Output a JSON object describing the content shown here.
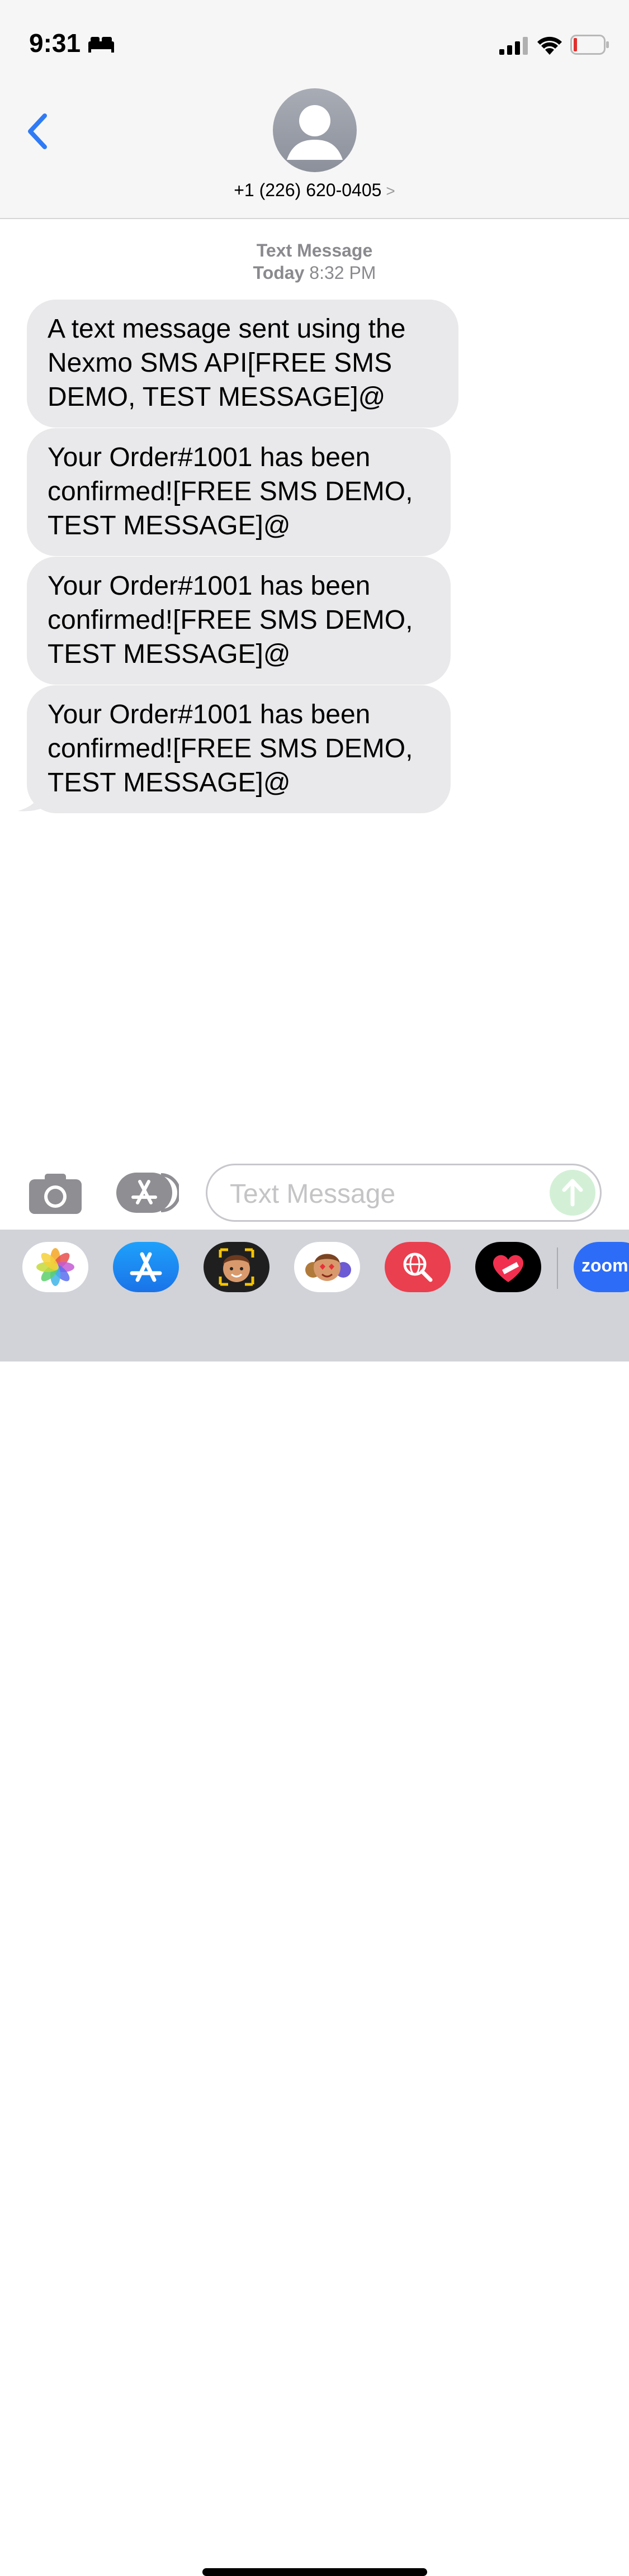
{
  "status_bar": {
    "time": "9:31",
    "icons": [
      "bed-icon",
      "cellular-signal-icon",
      "wifi-icon",
      "battery-low-icon"
    ]
  },
  "header": {
    "back_icon": "chevron-left-icon",
    "contact_number": "+1 (226) 620-0405",
    "detail_chevron": ">"
  },
  "conversation": {
    "service_label": "Text Message",
    "date_day": "Today",
    "date_time": "8:32 PM",
    "messages": [
      {
        "text": "A text message sent using the Nexmo SMS API[FREE SMS DEMO, TEST MESSAGE]@"
      },
      {
        "text": "Your Order#1001 has been confirmed![FREE SMS DEMO, TEST MESSAGE]@"
      },
      {
        "text": "Your Order#1001 has been confirmed![FREE SMS DEMO, TEST MESSAGE]@"
      },
      {
        "text": "Your Order#1001 has been confirmed![FREE SMS DEMO, TEST MESSAGE]@"
      }
    ]
  },
  "composer": {
    "placeholder": "Text Message",
    "value": ""
  },
  "app_drawer": {
    "apps": [
      "photos-icon",
      "app-store-icon",
      "memoji-icon",
      "animoji-icon",
      "web-search-icon",
      "heart-icon",
      "zoom-icon"
    ],
    "zoom_label": "zoom"
  },
  "colors": {
    "accent": "#1a73e8",
    "bubble": "#e9e9eb",
    "send_disabled": "#d3f0d7"
  }
}
